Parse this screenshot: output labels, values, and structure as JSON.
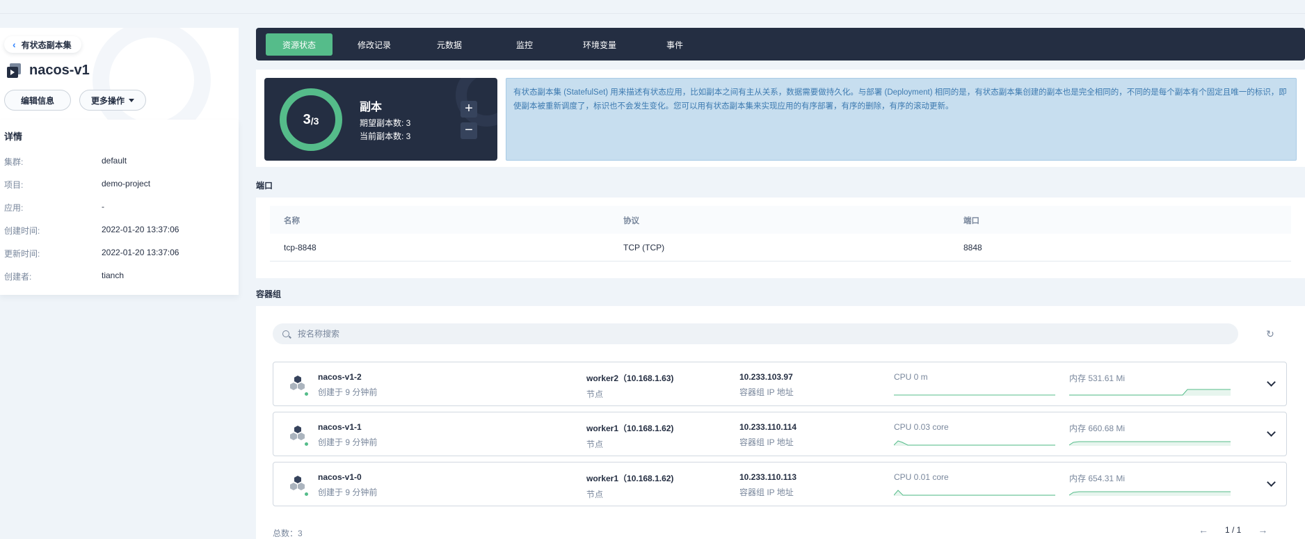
{
  "header": {
    "back_label": "有状态副本集",
    "title": "nacos-v1",
    "edit_label": "编辑信息",
    "more_label": "更多操作"
  },
  "details": {
    "heading": "详情",
    "rows": [
      {
        "key": "集群:",
        "value": "default"
      },
      {
        "key": "项目:",
        "value": "demo-project"
      },
      {
        "key": "应用:",
        "value": "-"
      },
      {
        "key": "创建时间:",
        "value": "2022-01-20 13:37:06"
      },
      {
        "key": "更新时间:",
        "value": "2022-01-20 13:37:06"
      },
      {
        "key": "创建者:",
        "value": "tianch"
      }
    ]
  },
  "tabs": [
    {
      "label": "资源状态",
      "active": true
    },
    {
      "label": "修改记录",
      "active": false
    },
    {
      "label": "元数据",
      "active": false
    },
    {
      "label": "监控",
      "active": false
    },
    {
      "label": "环境变量",
      "active": false
    },
    {
      "label": "事件",
      "active": false
    }
  ],
  "replicas": {
    "current": "3",
    "total": "/3",
    "title": "副本",
    "desired_label": "期望副本数: 3",
    "current_label": "当前副本数: 3",
    "plus": "+",
    "minus": "−",
    "info": "有状态副本集 (StatefulSet) 用来描述有状态应用，比如副本之间有主从关系，数据需要做持久化。与部署 (Deployment) 相同的是，有状态副本集创建的副本也是完全相同的，不同的是每个副本有个固定且唯一的标识，即使副本被重新调度了，标识也不会发生变化。您可以用有状态副本集来实现应用的有序部署，有序的删除，有序的滚动更新。"
  },
  "ports": {
    "section_label": "端口",
    "headers": {
      "name": "名称",
      "protocol": "协议",
      "port": "端口"
    },
    "rows": [
      {
        "name": "tcp-8848",
        "protocol": "TCP (TCP)",
        "port": "8848"
      }
    ]
  },
  "pods": {
    "section_label": "容器组",
    "search_placeholder": "按名称搜索",
    "node_label": "节点",
    "ip_label": "容器组 IP 地址",
    "items": [
      {
        "name": "nacos-v1-2",
        "created": "创建于 9 分钟前",
        "node": "worker2（10.168.1.63)",
        "ip": "10.233.103.97",
        "cpu": "CPU 0 m",
        "mem": "内存 531.61 Mi"
      },
      {
        "name": "nacos-v1-1",
        "created": "创建于 9 分钟前",
        "node": "worker1（10.168.1.62)",
        "ip": "10.233.110.114",
        "cpu": "CPU 0.03 core",
        "mem": "内存 660.68 Mi"
      },
      {
        "name": "nacos-v1-0",
        "created": "创建于 9 分钟前",
        "node": "worker1（10.168.1.62)",
        "ip": "10.233.110.113",
        "cpu": "CPU 0.01 core",
        "mem": "内存 654.31 Mi"
      }
    ],
    "total_label": "总数：3",
    "page_label": "1 / 1",
    "prev": "←",
    "next": "→"
  },
  "colors": {
    "accent": "#55bc8a",
    "dark": "#242e42",
    "info_bg": "#c7deef"
  }
}
